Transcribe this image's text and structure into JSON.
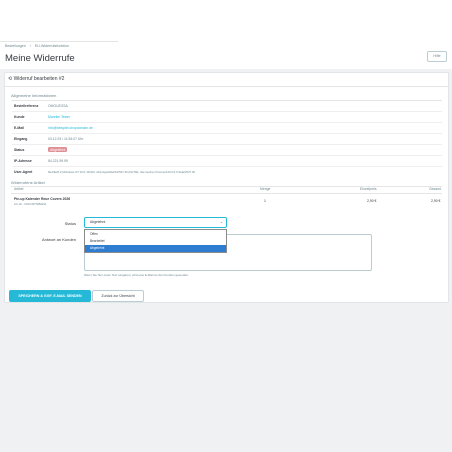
{
  "breadcrumb": [
    "Bestellungen",
    "/",
    "EU-Widerrufsfunktion"
  ],
  "page_title": "Meine Widerrufe",
  "help_label": "Hilfe",
  "card_title": "⟲ Widerruf bearbeiten #2",
  "general": {
    "title": "Allgemeine Informationen",
    "rows": [
      {
        "key": "Bestellreferenz",
        "value": "OMGUZGSA"
      },
      {
        "key": "Kunde",
        "value": "Mareike Tester"
      },
      {
        "key": "E-Mail",
        "value": "info@beispiel-shopdomain.de"
      },
      {
        "key": "Eingang",
        "value": "03.12.25 / 11:54:07 Uhr"
      },
      {
        "key": "Status",
        "value": "Abgelehnt"
      },
      {
        "key": "IP-Adresse",
        "value": "84.221.99.99"
      },
      {
        "key": "User-Agent",
        "value": "Mozilla/5.0 (Windows NT 10.0; Win64; x64) AppleWebKit/537.36 (KHTML, like Gecko) Chrome/143.0.0.0 Safari/537.36"
      }
    ]
  },
  "items": {
    "title": "Widerrufene Artikel",
    "headers": {
      "article": "Artikel",
      "qty": "Menge",
      "unit_price": "Einzelpreis",
      "total": "Gesamt"
    },
    "rows": [
      {
        "name": "Pin-up Kalender Reue Covers 2026",
        "ref": "Art.-Nr.: 0013-KPTABADA",
        "qty": "1",
        "unit_price": "2,90 €",
        "total": "2,90 €"
      }
    ]
  },
  "form": {
    "status_label": "Status",
    "status_value": "Abgelehnt",
    "options": [
      "Offen",
      "Bearbeitet",
      "Abgelehnt"
    ],
    "selected_index": 2,
    "reply_label": "Antwort an Kunden",
    "hint": "Wenn Sie hier einen Text eingeben, wird eine E-Mail an den Kunden gesendet."
  },
  "buttons": {
    "save": "SPEICHERN & GGF. E-MAIL SENDEN",
    "back": "Zurück zur Übersicht"
  },
  "colors": {
    "accent": "#25b9d7",
    "danger_badge": "#e08f95",
    "selected_option": "#2f7dd1"
  }
}
